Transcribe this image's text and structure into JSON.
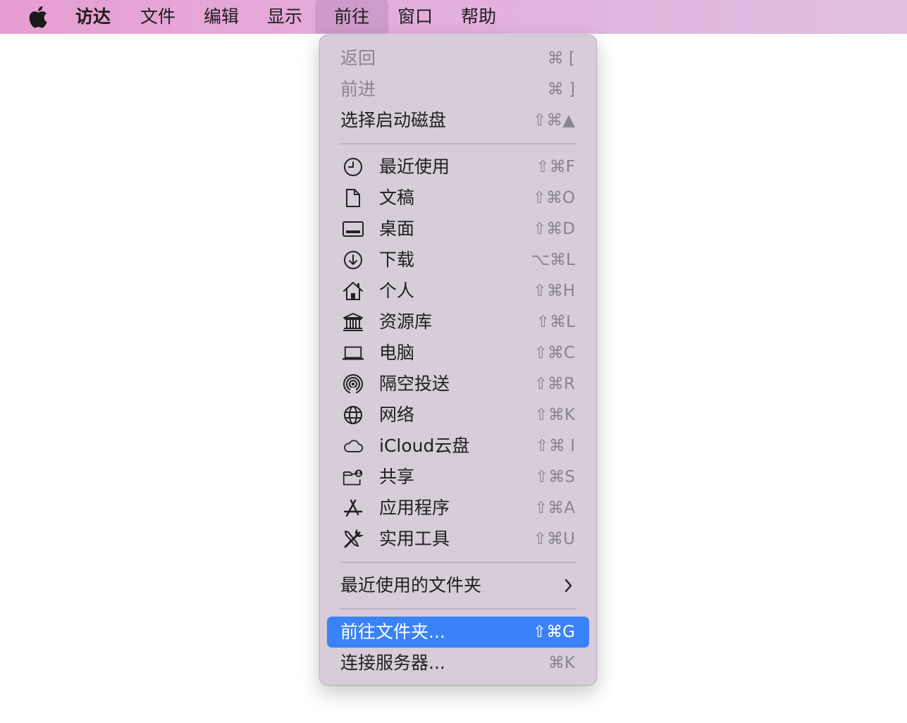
{
  "menubar": {
    "apple_icon": "apple-logo-icon",
    "app_name": "访达",
    "items": [
      "文件",
      "编辑",
      "显示",
      "前往",
      "窗口",
      "帮助"
    ],
    "active_item": "前往",
    "colors": {
      "gradient_start": "#e79ed1",
      "gradient_end": "#dfc0e2"
    }
  },
  "menu": {
    "top_items": [
      {
        "label": "返回",
        "shortcut": "⌘ [",
        "disabled": true
      },
      {
        "label": "前进",
        "shortcut": "⌘ ]",
        "disabled": true
      },
      {
        "label": "选择启动磁盘",
        "shortcut": "⇧⌘▲",
        "disabled": false
      }
    ],
    "places": [
      {
        "label": "最近使用",
        "shortcut": "⇧⌘F",
        "icon": "clock-icon"
      },
      {
        "label": "文稿",
        "shortcut": "⇧⌘O",
        "icon": "document-icon"
      },
      {
        "label": "桌面",
        "shortcut": "⇧⌘D",
        "icon": "desktop-icon"
      },
      {
        "label": "下载",
        "shortcut": "⌥⌘L",
        "icon": "download-icon"
      },
      {
        "label": "个人",
        "shortcut": "⇧⌘H",
        "icon": "home-icon"
      },
      {
        "label": "资源库",
        "shortcut": "⇧⌘L",
        "icon": "library-icon"
      },
      {
        "label": "电脑",
        "shortcut": "⇧⌘C",
        "icon": "laptop-icon"
      },
      {
        "label": "隔空投送",
        "shortcut": "⇧⌘R",
        "icon": "airdrop-icon"
      },
      {
        "label": "网络",
        "shortcut": "⇧⌘K",
        "icon": "globe-icon"
      },
      {
        "label": "iCloud云盘",
        "shortcut": "⇧⌘ I",
        "icon": "cloud-icon"
      },
      {
        "label": "共享",
        "shortcut": "⇧⌘S",
        "icon": "shared-folder-icon"
      },
      {
        "label": "应用程序",
        "shortcut": "⇧⌘A",
        "icon": "app-store-icon"
      },
      {
        "label": "实用工具",
        "shortcut": "⇧⌘U",
        "icon": "tools-icon"
      }
    ],
    "recent_folders": {
      "label": "最近使用的文件夹",
      "chevron": "›"
    },
    "goto_folder": {
      "label": "前往文件夹...",
      "shortcut": "⇧⌘G",
      "highlighted": true
    },
    "connect_server": {
      "label": "连接服务器...",
      "shortcut": "⌘K"
    },
    "colors": {
      "background": "#d6cdd8",
      "highlight": "#3a82f7",
      "disabled_text": "#8c858f"
    }
  }
}
